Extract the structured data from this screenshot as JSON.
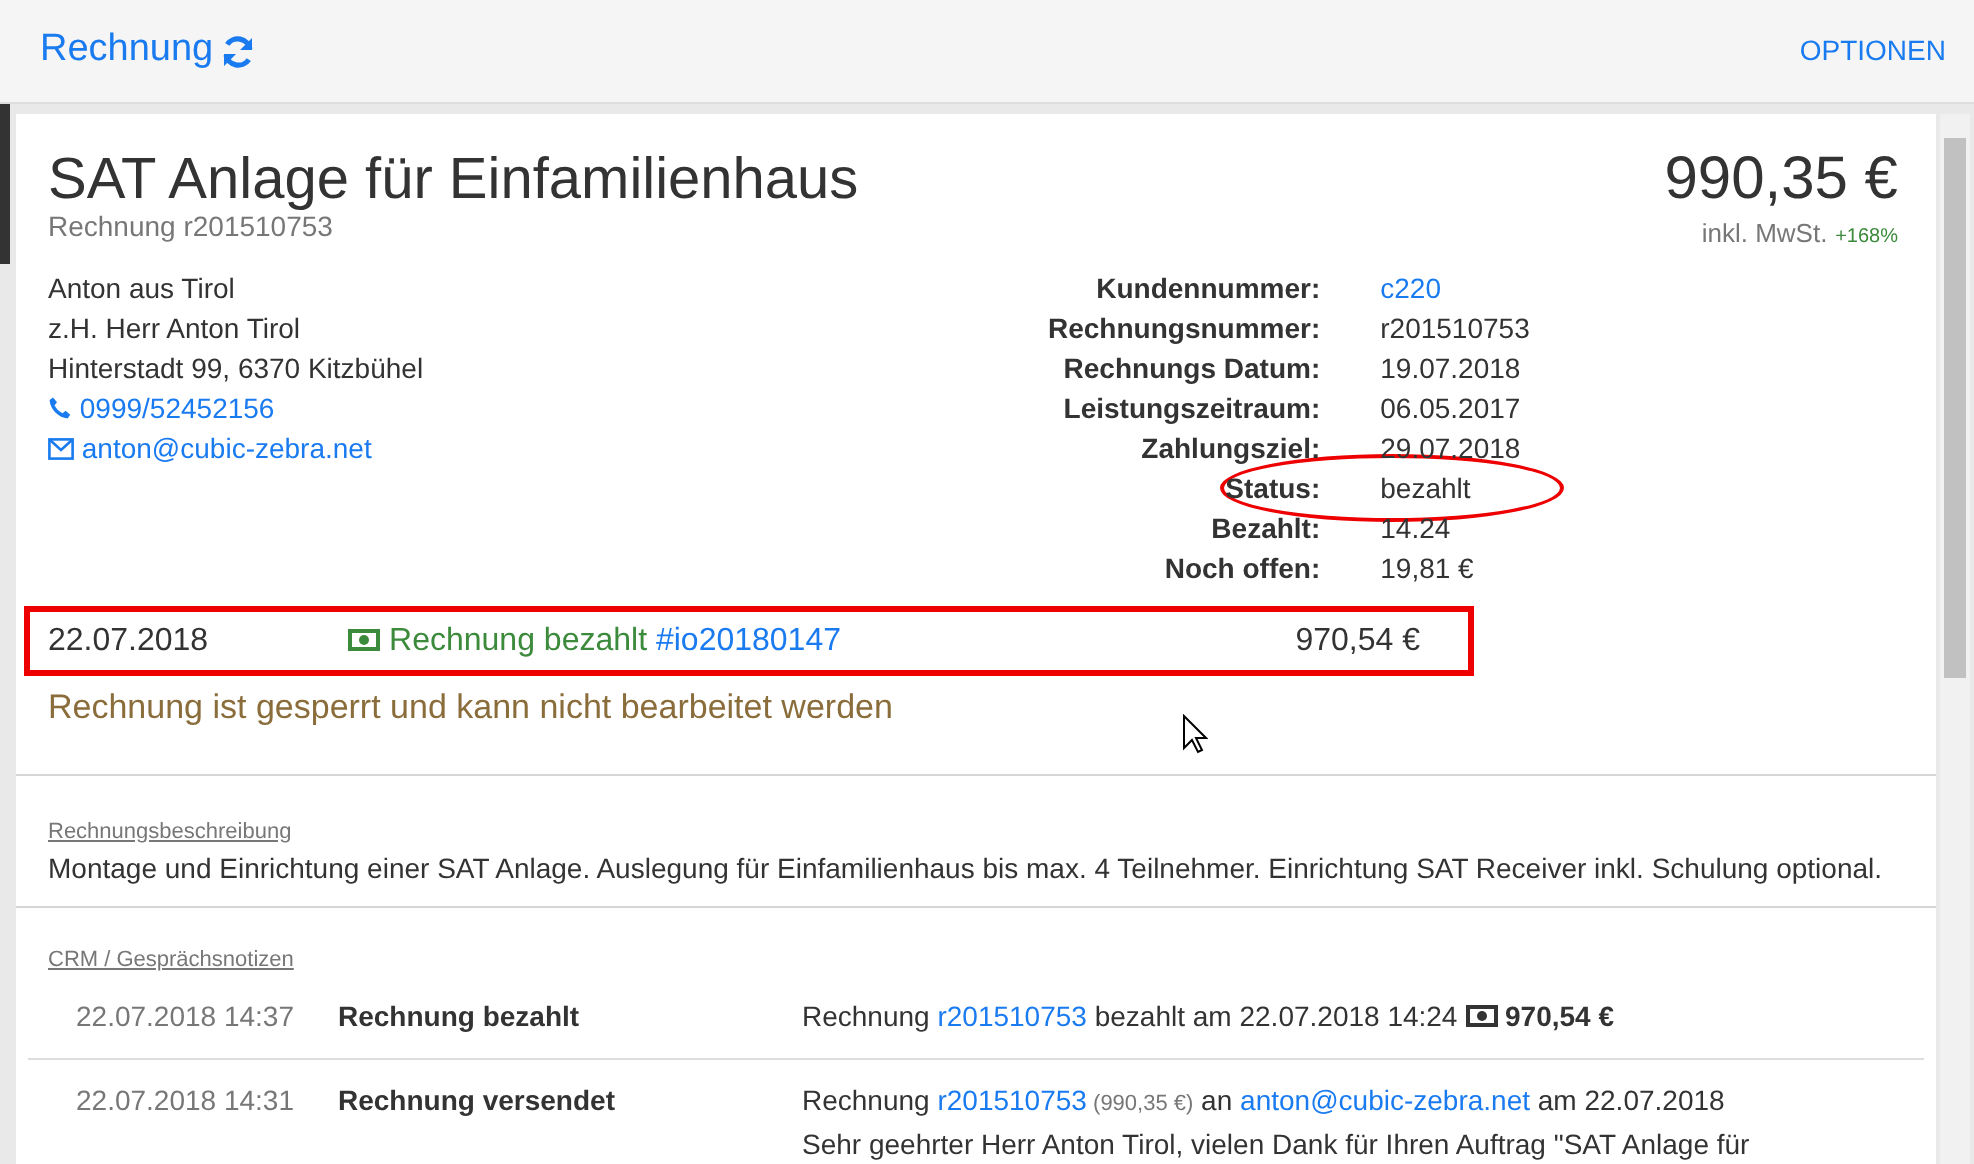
{
  "header": {
    "title": "Rechnung",
    "options": "OPTIONEN"
  },
  "invoice": {
    "title": "SAT Anlage für Einfamilienhaus",
    "subtitle": "Rechnung r201510753",
    "total": "990,35 €",
    "tax_note": "inkl. MwSt.",
    "margin": "+168%"
  },
  "customer": {
    "lines": [
      "Anton aus Tirol",
      "z.H. Herr Anton Tirol",
      "Hinterstadt 99, 6370 Kitzbühel"
    ],
    "phone": "0999/52452156",
    "email": "anton@cubic-zebra.net"
  },
  "details": [
    {
      "label": "Kundennummer:",
      "value": "c220",
      "kind": "link",
      "highlighted": false
    },
    {
      "label": "Rechnungsnummer:",
      "value": "r201510753",
      "kind": "text",
      "highlighted": false
    },
    {
      "label": "Rechnungs Datum:",
      "value": "19.07.2018",
      "kind": "text",
      "highlighted": false
    },
    {
      "label": "Leistungszeitraum:",
      "value": "06.05.2017",
      "kind": "text",
      "highlighted": false
    },
    {
      "label": "Zahlungsziel:",
      "value": "29.07.2018",
      "kind": "text",
      "highlighted": false
    },
    {
      "label": "Status:",
      "value": "bezahlt",
      "kind": "text",
      "highlighted": true
    },
    {
      "label": "Bezahlt:",
      "value": "14.24",
      "kind": "text",
      "highlighted": false
    },
    {
      "label": "Noch offen:",
      "value": "19,81 €",
      "kind": "text",
      "highlighted": false
    }
  ],
  "payment": {
    "date": "22.07.2018",
    "text": "Rechnung bezahlt",
    "reference": "#io20180147",
    "amount": "970,54 €",
    "highlighted": true
  },
  "lock_notice": "Rechnung ist gesperrt und kann nicht bearbeitet werden",
  "description": {
    "heading": "Rechnungsbeschreibung",
    "text": "Montage und Einrichtung einer SAT Anlage. Auslegung für Einfamilienhaus bis max. 4 Teilnehmer. Einrichtung SAT Receiver inkl. Schulung optional."
  },
  "crm": {
    "heading": "CRM / Gesprächsnotizen",
    "entries": [
      {
        "time": "22.07.2018 14:37",
        "title": "Rechnung bezahlt",
        "parts": [
          {
            "kind": "text",
            "text": "Rechnung "
          },
          {
            "kind": "link",
            "text": "r201510753"
          },
          {
            "kind": "text",
            "text": " bezahlt am 22.07.2018 14:24 "
          },
          {
            "kind": "money",
            "text": "970,54 €"
          }
        ]
      },
      {
        "time": "22.07.2018 14:31",
        "title": "Rechnung versendet",
        "parts": [
          {
            "kind": "text",
            "text": "Rechnung "
          },
          {
            "kind": "link",
            "text": "r201510753"
          },
          {
            "kind": "small",
            "text": " (990,35 €)"
          },
          {
            "kind": "text",
            "text": " an "
          },
          {
            "kind": "link",
            "text": "anton@cubic-zebra.net"
          },
          {
            "kind": "text",
            "text": " am 22.07.2018"
          }
        ],
        "preview": "Sehr geehrter Herr Anton Tirol, vielen Dank für Ihren Auftrag \"SAT Anlage für"
      }
    ]
  }
}
